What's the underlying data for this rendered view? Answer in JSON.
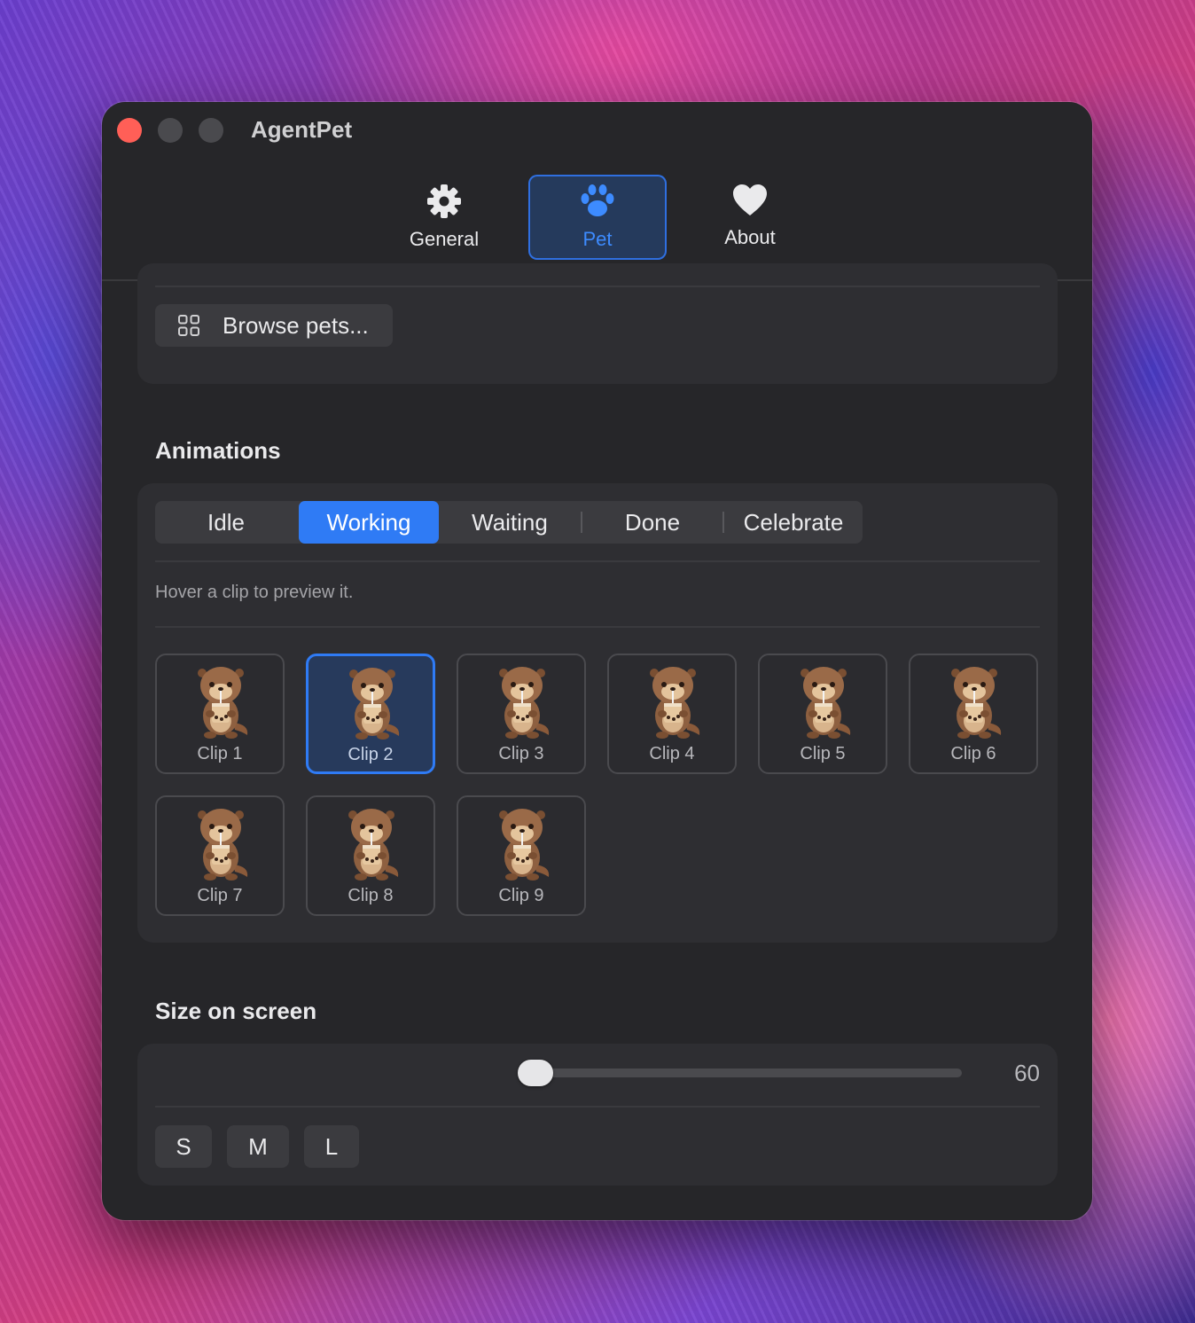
{
  "window": {
    "title": "AgentPet"
  },
  "toolbar": {
    "tabs": [
      {
        "label": "General",
        "icon": "gear-icon"
      },
      {
        "label": "Pet",
        "icon": "paw-icon",
        "active": true
      },
      {
        "label": "About",
        "icon": "heart-icon"
      }
    ]
  },
  "pets": {
    "browse_label": "Browse pets..."
  },
  "animations": {
    "heading": "Animations",
    "states": [
      "Idle",
      "Working",
      "Waiting",
      "Done",
      "Celebrate"
    ],
    "selected_state": "Working",
    "hint": "Hover a clip to preview it.",
    "clips": [
      "Clip 1",
      "Clip 2",
      "Clip 3",
      "Clip 4",
      "Clip 5",
      "Clip 6",
      "Clip 7",
      "Clip 8",
      "Clip 9"
    ],
    "selected_clip": "Clip 2"
  },
  "size": {
    "heading": "Size on screen",
    "value": "60",
    "presets": [
      "S",
      "M",
      "L"
    ]
  },
  "colors": {
    "accent": "#2f7bf5",
    "window_bg": "#262629",
    "card_bg": "#2e2e32",
    "close": "#ff5f57"
  }
}
